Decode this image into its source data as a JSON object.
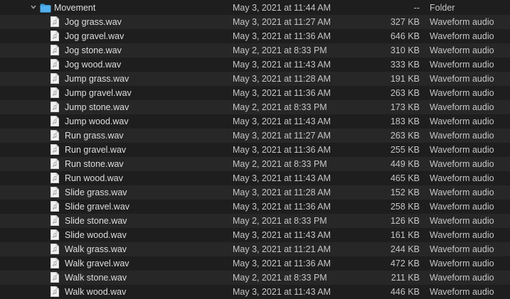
{
  "folder": {
    "name": "Movement",
    "date": "May 3, 2021 at 11:44 AM",
    "size": "--",
    "kind": "Folder",
    "disclosure_icon": "chevron-down-icon",
    "icon": "folder-icon",
    "icon_color": "#3a9bdc"
  },
  "files": [
    {
      "name": "Jog grass.wav",
      "date": "May 3, 2021 at 11:27 AM",
      "size": "327 KB",
      "kind": "Waveform audio"
    },
    {
      "name": "Jog gravel.wav",
      "date": "May 3, 2021 at 11:36 AM",
      "size": "646 KB",
      "kind": "Waveform audio"
    },
    {
      "name": "Jog stone.wav",
      "date": "May 2, 2021 at 8:33 PM",
      "size": "310 KB",
      "kind": "Waveform audio"
    },
    {
      "name": "Jog wood.wav",
      "date": "May 3, 2021 at 11:43 AM",
      "size": "333 KB",
      "kind": "Waveform audio"
    },
    {
      "name": "Jump grass.wav",
      "date": "May 3, 2021 at 11:28 AM",
      "size": "191 KB",
      "kind": "Waveform audio"
    },
    {
      "name": "Jump gravel.wav",
      "date": "May 3, 2021 at 11:36 AM",
      "size": "263 KB",
      "kind": "Waveform audio"
    },
    {
      "name": "Jump stone.wav",
      "date": "May 2, 2021 at 8:33 PM",
      "size": "173 KB",
      "kind": "Waveform audio"
    },
    {
      "name": "Jump wood.wav",
      "date": "May 3, 2021 at 11:43 AM",
      "size": "183 KB",
      "kind": "Waveform audio"
    },
    {
      "name": "Run grass.wav",
      "date": "May 3, 2021 at 11:27 AM",
      "size": "263 KB",
      "kind": "Waveform audio"
    },
    {
      "name": "Run gravel.wav",
      "date": "May 3, 2021 at 11:36 AM",
      "size": "255 KB",
      "kind": "Waveform audio"
    },
    {
      "name": "Run stone.wav",
      "date": "May 2, 2021 at 8:33 PM",
      "size": "449 KB",
      "kind": "Waveform audio"
    },
    {
      "name": "Run wood.wav",
      "date": "May 3, 2021 at 11:43 AM",
      "size": "465 KB",
      "kind": "Waveform audio"
    },
    {
      "name": "Slide grass.wav",
      "date": "May 3, 2021 at 11:28 AM",
      "size": "152 KB",
      "kind": "Waveform audio"
    },
    {
      "name": "Slide gravel.wav",
      "date": "May 3, 2021 at 11:36 AM",
      "size": "258 KB",
      "kind": "Waveform audio"
    },
    {
      "name": "Slide stone.wav",
      "date": "May 2, 2021 at 8:33 PM",
      "size": "126 KB",
      "kind": "Waveform audio"
    },
    {
      "name": "Slide wood.wav",
      "date": "May 3, 2021 at 11:43 AM",
      "size": "161 KB",
      "kind": "Waveform audio"
    },
    {
      "name": "Walk grass.wav",
      "date": "May 3, 2021 at 11:21 AM",
      "size": "244 KB",
      "kind": "Waveform audio"
    },
    {
      "name": "Walk gravel.wav",
      "date": "May 3, 2021 at 11:36 AM",
      "size": "472 KB",
      "kind": "Waveform audio"
    },
    {
      "name": "Walk stone.wav",
      "date": "May 2, 2021 at 8:33 PM",
      "size": "211 KB",
      "kind": "Waveform audio"
    },
    {
      "name": "Walk wood.wav",
      "date": "May 3, 2021 at 11:43 AM",
      "size": "446 KB",
      "kind": "Waveform audio"
    }
  ],
  "file_icon": "audio-file-icon"
}
